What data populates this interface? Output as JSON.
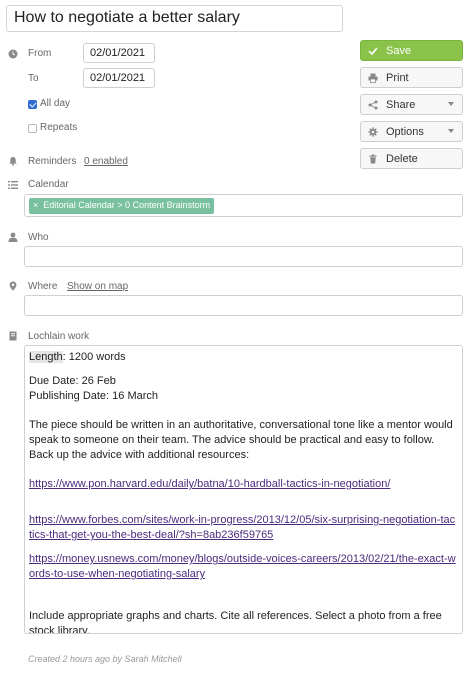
{
  "event": {
    "title": "How to negotiate a better salary",
    "from_label": "From",
    "from_value": "02/01/2021",
    "to_label": "To",
    "to_value": "02/01/2021",
    "all_day_label": "All day",
    "all_day_checked": true,
    "repeats_label": "Repeats",
    "repeats_checked": false,
    "reminders_label": "Reminders",
    "reminders_link": "0 enabled",
    "calendar_label": "Calendar",
    "calendar_tag_remove": "×",
    "calendar_tag": "Editorial Calendar > 0 Content Brainstorm",
    "who_label": "Who",
    "who_value": "",
    "where_label": "Where",
    "where_link": "Show on map",
    "where_value": "",
    "notes_label": "Lochlain work"
  },
  "notes": {
    "length_prefix": "Length",
    "length_rest": ": 1200 words",
    "due_date": "Due Date: 26 Feb",
    "publishing_date": "Publishing Date: 16 March",
    "body": "The piece should be written in an authoritative, conversational tone like a mentor would speak to someone on their team. The advice should be practical and easy to follow. Back up the advice with additional resources:",
    "links": [
      "https://www.pon.harvard.edu/daily/batna/10-hardball-tactics-in-negotiation/",
      "https://www.forbes.com/sites/work-in-progress/2013/12/05/six-surprising-negotiation-tactics-that-get-you-the-best-deal/?sh=8ab236f59765",
      "https://money.usnews.com/money/blogs/outside-voices-careers/2013/02/21/the-exact-words-to-use-when-negotiating-salary"
    ],
    "closing": "Include appropriate graphs and charts. Cite all references. Select a photo from a free stock library."
  },
  "footer": "Created 2 hours ago by Sarah Mitchell",
  "actions": {
    "save": "Save",
    "print": "Print",
    "share": "Share",
    "options": "Options",
    "delete": "Delete"
  },
  "icons": {
    "clock": "clock-icon",
    "bell": "bell-icon",
    "list": "list-icon",
    "person": "person-icon",
    "pin": "map-pin-icon",
    "note": "note-icon"
  },
  "colors": {
    "save_green": "#8bc34a",
    "tag_green": "#78c0a0",
    "checkbox_blue": "#2f6fd1",
    "link_purple": "#4b2b7d"
  }
}
